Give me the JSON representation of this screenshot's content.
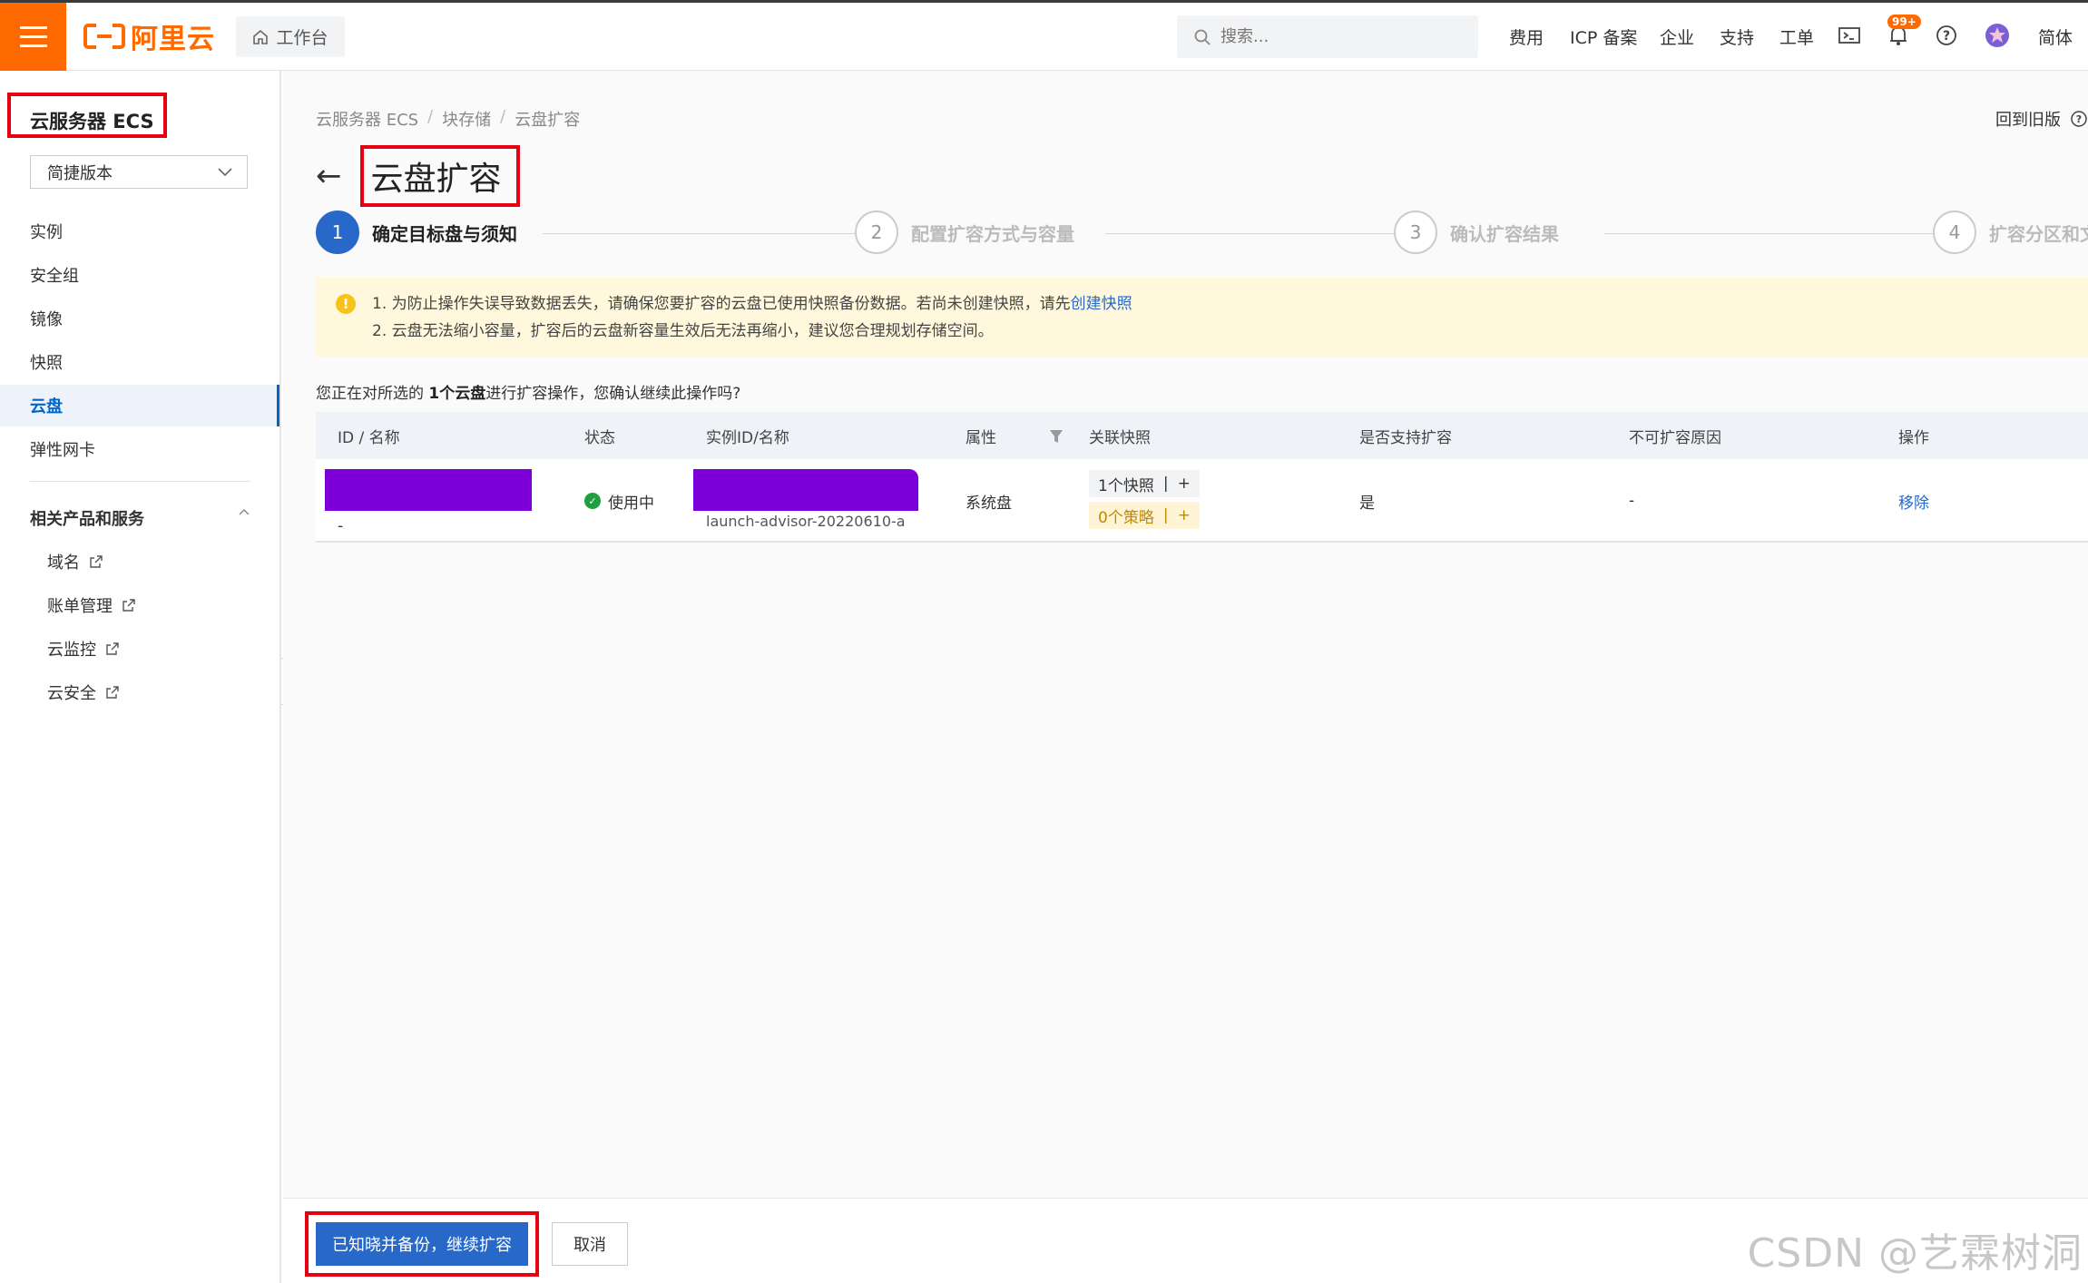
{
  "topbar": {
    "logo_text": "阿里云",
    "workbench_label": "工作台",
    "search_placeholder": "搜索...",
    "links": [
      "费用",
      "ICP 备案",
      "企业",
      "支持",
      "工单"
    ],
    "notification_badge": "99+",
    "lang_label": "简体"
  },
  "sidebar": {
    "title": "云服务器 ECS",
    "version_select": "简捷版本",
    "items": [
      "实例",
      "安全组",
      "镜像",
      "快照",
      "云盘",
      "弹性网卡"
    ],
    "active_item": "云盘",
    "section_title": "相关产品和服务",
    "related": [
      "域名",
      "账单管理",
      "云监控",
      "云安全"
    ]
  },
  "main": {
    "breadcrumb": [
      "云服务器 ECS",
      "块存储",
      "云盘扩容"
    ],
    "back_old_label": "回到旧版",
    "page_title": "云盘扩容",
    "steps": [
      {
        "num": "1",
        "label": "确定目标盘与须知"
      },
      {
        "num": "2",
        "label": "配置扩容方式与容量"
      },
      {
        "num": "3",
        "label": "确认扩容结果"
      },
      {
        "num": "4",
        "label": "扩容分区和文"
      }
    ],
    "notice": {
      "line1_prefix": "1. 为防止操作失误导致数据丢失，请确保您要扩容的云盘已使用快照备份数据。若尚未创建快照，请先",
      "line1_link": "创建快照",
      "line2": "2. 云盘无法缩小容量，扩容后的云盘新容量生效后无法再缩小，建议您合理规划存储空间。"
    },
    "confirm_prefix": "您正在对所选的 ",
    "confirm_bold": "1个云盘",
    "confirm_suffix": "进行扩容操作，您确认继续此操作吗?",
    "table": {
      "headers": [
        "ID / 名称",
        "状态",
        "实例ID/名称",
        "属性",
        "关联快照",
        "是否支持扩容",
        "不可扩容原因",
        "操作"
      ],
      "rows": [
        {
          "id_sub": "-",
          "status": "使用中",
          "instance_sub": "launch-advisor-20220610-a",
          "attr": "系统盘",
          "snapshot": "1个快照",
          "policy": "0个策略",
          "expandable": "是",
          "reason": "-",
          "action": "移除"
        }
      ]
    }
  },
  "footer": {
    "confirm_label": "已知晓并备份，继续扩容",
    "cancel_label": "取消",
    "watermark": "CSDN @艺霖树洞"
  },
  "colors": {
    "brand": "#ff6a00",
    "primary": "#2768c9",
    "highlight_box": "#e60012",
    "redaction": "#7b00d9"
  }
}
